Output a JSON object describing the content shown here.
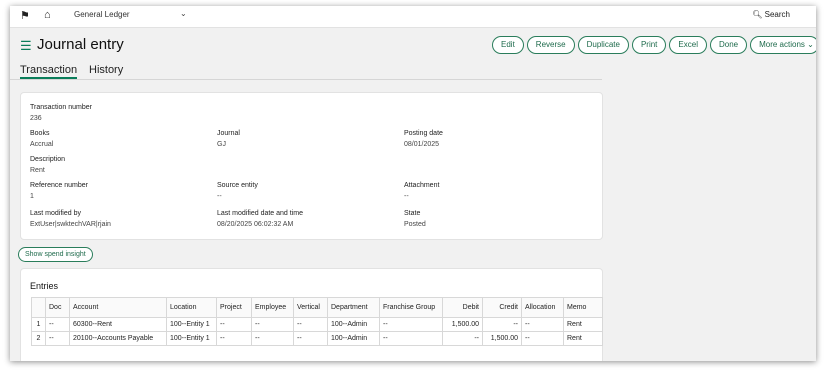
{
  "topbar": {
    "ledger": "General Ledger",
    "caret": "⌄",
    "search": "Search"
  },
  "header": {
    "title": "Journal entry",
    "actions": [
      "Edit",
      "Reverse",
      "Duplicate",
      "Print",
      "Excel",
      "Done"
    ],
    "more_actions": "More actions"
  },
  "tabs": [
    "Transaction",
    "History"
  ],
  "transaction": {
    "transaction_number": {
      "label": "Transaction number",
      "value": "236"
    },
    "books": {
      "label": "Books",
      "value": "Accrual"
    },
    "journal": {
      "label": "Journal",
      "value": "GJ"
    },
    "posting_date": {
      "label": "Posting date",
      "value": "08/01/2025"
    },
    "description": {
      "label": "Description",
      "value": "Rent"
    },
    "reference_number": {
      "label": "Reference number",
      "value": "1"
    },
    "source_entity": {
      "label": "Source entity",
      "value": "--"
    },
    "attachment": {
      "label": "Attachment",
      "value": "--"
    },
    "last_modified_by": {
      "label": "Last modified by",
      "value": "ExtUser|swktechVAR|rjain"
    },
    "last_modified_date": {
      "label": "Last modified date and time",
      "value": "08/20/2025 06:02:32 AM"
    },
    "state": {
      "label": "State",
      "value": "Posted"
    }
  },
  "insight_button": "Show spend insight",
  "entries": {
    "title": "Entries",
    "columns": [
      "",
      "Doc",
      "Account",
      "Location",
      "Project",
      "Employee",
      "Vertical",
      "Department",
      "Franchise Group",
      "Debit",
      "Credit",
      "Allocation",
      "Memo"
    ],
    "rows": [
      [
        "1",
        "--",
        "60300--Rent",
        "100--Entity 1",
        "--",
        "--",
        "--",
        "100--Admin",
        "--",
        "1,500.00",
        "--",
        "--",
        "Rent"
      ],
      [
        "2",
        "--",
        "20100--Accounts Payable",
        "100--Entity 1",
        "--",
        "--",
        "--",
        "100--Admin",
        "--",
        "--",
        "1,500.00",
        "--",
        "Rent"
      ]
    ]
  },
  "colors": {
    "accent": "#0a7d5a",
    "button_border": "#2a7d5b"
  }
}
